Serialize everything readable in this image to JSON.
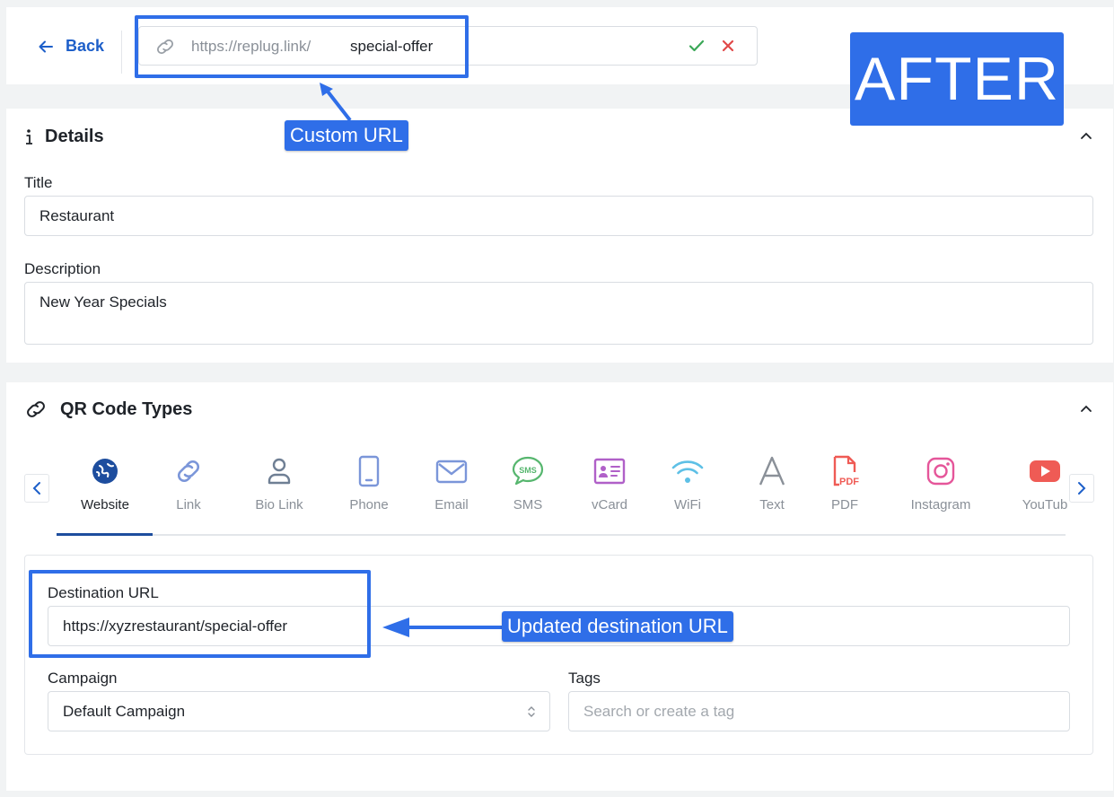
{
  "topbar": {
    "back_label": "Back",
    "url_prefix": "https://replug.link/",
    "url_slug": "special-offer"
  },
  "annotations": {
    "custom_url": "Custom URL",
    "updated_destination": "Updated destination URL",
    "after_badge": "AFTER"
  },
  "details": {
    "title": "Details",
    "title_label": "Title",
    "title_value": "Restaurant",
    "description_label": "Description",
    "description_value": "New Year Specials"
  },
  "qr_types": {
    "title": "QR Code Types",
    "active": "Website",
    "items": [
      {
        "label": "Website",
        "icon": "globe-icon"
      },
      {
        "label": "Link",
        "icon": "link-icon"
      },
      {
        "label": "Bio Link",
        "icon": "user-icon"
      },
      {
        "label": "Phone",
        "icon": "phone-icon"
      },
      {
        "label": "Email",
        "icon": "email-icon"
      },
      {
        "label": "SMS",
        "icon": "sms-icon"
      },
      {
        "label": "vCard",
        "icon": "vcard-icon"
      },
      {
        "label": "WiFi",
        "icon": "wifi-icon"
      },
      {
        "label": "Text",
        "icon": "text-icon"
      },
      {
        "label": "PDF",
        "icon": "pdf-icon"
      },
      {
        "label": "Instagram",
        "icon": "instagram-icon"
      },
      {
        "label": "YouTub",
        "icon": "youtube-icon"
      }
    ]
  },
  "form": {
    "destination_label": "Destination URL",
    "destination_value": "https://xyzrestaurant/special-offer",
    "campaign_label": "Campaign",
    "campaign_value": "Default Campaign",
    "tags_label": "Tags",
    "tags_placeholder": "Search or create a tag"
  },
  "colors": {
    "accent": "#2f6ee8",
    "link_blue": "#1d5fc9",
    "active_underline": "#1d4d9e",
    "check_green": "#3aa757",
    "cancel_red": "#e04848"
  }
}
